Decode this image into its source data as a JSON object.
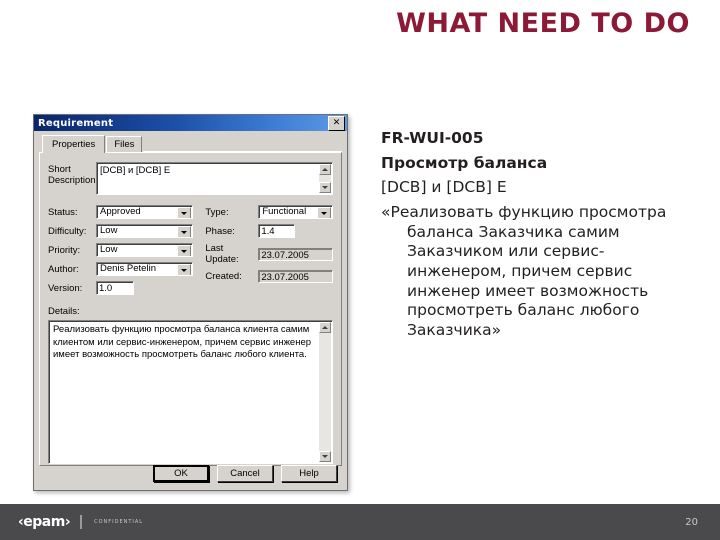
{
  "slide": {
    "title": "WHAT NEED TO DO",
    "title_color": "#8C1A36",
    "background": "#ffffff"
  },
  "right_panel": {
    "req_id": "FR-WUI-005",
    "req_name": "Просмотр баланса",
    "short_desc": "[DCB] и [DCB] E",
    "quote": "«Реализовать функцию просмотра баланса Заказчика самим Заказчиком или сервис-инженером, причем сервис инженер имеет возможность просмотреть баланс любого Заказчика»"
  },
  "dialog": {
    "title": "Requirement",
    "close_label": "✕",
    "tabs": [
      {
        "label": "Properties",
        "active": true
      },
      {
        "label": "Files",
        "active": false
      }
    ],
    "short_description": {
      "label": "Short Description:",
      "value": "[DCB] и [DCB] E"
    },
    "fields_left": [
      {
        "label": "Status:",
        "value": "Approved",
        "type": "combo"
      },
      {
        "label": "Difficulty:",
        "value": "Low",
        "type": "combo"
      },
      {
        "label": "Priority:",
        "value": "Low",
        "type": "combo"
      },
      {
        "label": "Author:",
        "value": "Denis Petelin",
        "type": "combo"
      },
      {
        "label": "Version:",
        "value": "1.0",
        "type": "input"
      }
    ],
    "fields_right": [
      {
        "label": "Type:",
        "value": "Functional",
        "type": "combo"
      },
      {
        "label": "Phase:",
        "value": "1.4",
        "type": "input"
      },
      {
        "label": "Last Update:",
        "value": "23.07.2005",
        "type": "readonly"
      },
      {
        "label": "Created:",
        "value": "23.07.2005",
        "type": "readonly"
      }
    ],
    "details": {
      "label": "Details:",
      "value": "Реализовать функцию просмотра баланса клиента самим клиентом или сервис-инженером, причем сервис инженер имеет возможность просмотреть баланс любого клиента."
    },
    "buttons": {
      "ok": "OK",
      "cancel": "Cancel",
      "help": "Help"
    }
  },
  "footer": {
    "logo": "‹epam›",
    "confidential": "CONFIDENTIAL",
    "page_number": "20"
  }
}
